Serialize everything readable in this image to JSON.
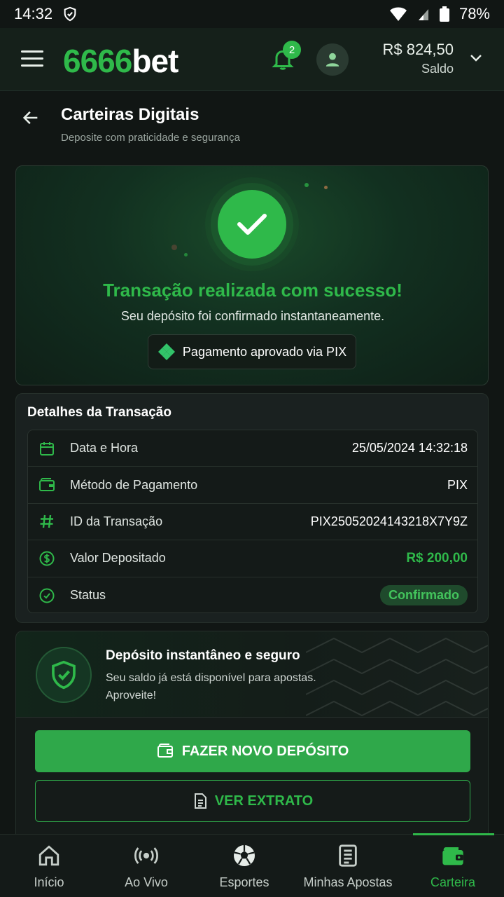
{
  "status_bar": {
    "time": "14:32",
    "battery": "78%"
  },
  "top_bar": {
    "logo_number": "6666",
    "logo_text": "bet",
    "notification_count": "2",
    "balance_amount": "R$ 824,50",
    "balance_label": "Saldo"
  },
  "page": {
    "title": "Carteiras Digitais",
    "subtitle": "Deposite com praticidade e segurança"
  },
  "success": {
    "title": "Transação realizada com sucesso!",
    "description": "Seu depósito foi confirmado instantaneamente.",
    "payment_pill": "Pagamento aprovado via PIX"
  },
  "details": {
    "title": "Detalhes da Transação",
    "rows": [
      {
        "label": "Data e Hora",
        "value": "25/05/2024 14:32:18",
        "icon": "calendar-icon"
      },
      {
        "label": "Método de Pagamento",
        "value": "PIX",
        "icon": "wallet-icon"
      },
      {
        "label": "ID da Transação",
        "value": "PIX25052024143218X7Y9Z",
        "icon": "hash-icon"
      },
      {
        "label": "Valor Depositado",
        "value": "R$ 200,00",
        "icon": "dollar-circle-icon"
      },
      {
        "label": "Status",
        "value": "Confirmado",
        "icon": "check-circle-icon"
      }
    ]
  },
  "info": {
    "title": "Depósito instantâneo e seguro",
    "text": "Seu saldo já está disponível para apostas. Aproveite!"
  },
  "actions": {
    "primary_label": "FAZER NOVO DEPÓSITO",
    "secondary_label": "VER EXTRATO"
  },
  "bottom_nav": {
    "items": [
      {
        "label": "Início",
        "icon": "home-icon"
      },
      {
        "label": "Ao Vivo",
        "icon": "live-broadcast-icon"
      },
      {
        "label": "Esportes",
        "icon": "soccer-ball-icon"
      },
      {
        "label": "Minhas Apostas",
        "icon": "bet-slip-icon"
      },
      {
        "label": "Carteira",
        "icon": "wallet-icon"
      }
    ],
    "active_index": 4
  },
  "colors": {
    "accent": "#2fb94a",
    "background": "#111614",
    "card": "#1a2120"
  }
}
